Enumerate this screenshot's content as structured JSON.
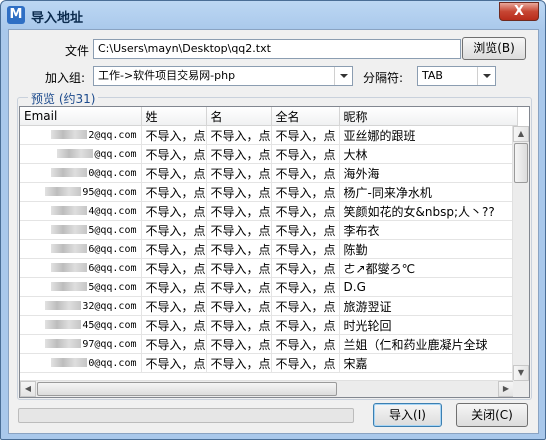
{
  "window": {
    "title": "导入地址",
    "app_icon": "M",
    "close_glyph": "X"
  },
  "form": {
    "file_label": "文件",
    "file_value": "C:\\Users\\mayn\\Desktop\\qq2.txt",
    "browse_label": "浏览(B)",
    "group_label": "加入组:",
    "group_value": "工作->软件项目交易网-php",
    "separator_label": "分隔符:",
    "separator_value": "TAB"
  },
  "preview": {
    "legend": "预览 (约31)",
    "columns": [
      "Email",
      "姓",
      "名",
      "全名",
      "昵称"
    ],
    "rows": [
      [
        "2@qq.com",
        "不导入，点",
        "不导入，点",
        "不导入，点",
        "亚丝娜的跟班"
      ],
      [
        "@qq.com",
        "不导入，点",
        "不导入，点",
        "不导入，点",
        "大林"
      ],
      [
        "0@qq.com",
        "不导入，点",
        "不导入，点",
        "不导入，点",
        "海外海"
      ],
      [
        "95@qq.com",
        "不导入，点",
        "不导入，点",
        "不导入，点",
        "杨广-同来净水机"
      ],
      [
        "4@qq.com",
        "不导入，点",
        "不导入，点",
        "不导入，点",
        "笑颜如花的女&nbsp;人丶??"
      ],
      [
        "5@qq.com",
        "不导入，点",
        "不导入，点",
        "不导入，点",
        "李布衣"
      ],
      [
        "6@qq.com",
        "不导入，点",
        "不导入，点",
        "不导入，点",
        "陈勤"
      ],
      [
        "6@qq.com",
        "不导入，点",
        "不导入，点",
        "不导入，点",
        "ㄜ↗都燮ろ℃"
      ],
      [
        "5@qq.com",
        "不导入，点",
        "不导入，点",
        "不导入，点",
        "D.G"
      ],
      [
        "32@qq.com",
        "不导入，点",
        "不导入，点",
        "不导入，点",
        "旅游翌证"
      ],
      [
        "45@qq.com",
        "不导入，点",
        "不导入，点",
        "不导入，点",
        "时光轮回"
      ],
      [
        "97@qq.com",
        "不导入，点",
        "不导入，点",
        "不导入，点",
        "兰姐（仁和药业鹿凝片全球"
      ],
      [
        "0@qq.com",
        "不导入，点",
        "不导入，点",
        "不导入，点",
        "宋嘉"
      ]
    ]
  },
  "progress": {
    "value": 0
  },
  "buttons": {
    "import_label": "导入(I)",
    "close_label": "关闭(C)"
  },
  "icons": {
    "app": "mail-icon",
    "up": "▲",
    "down": "▼",
    "left": "◀",
    "right": "▶"
  }
}
